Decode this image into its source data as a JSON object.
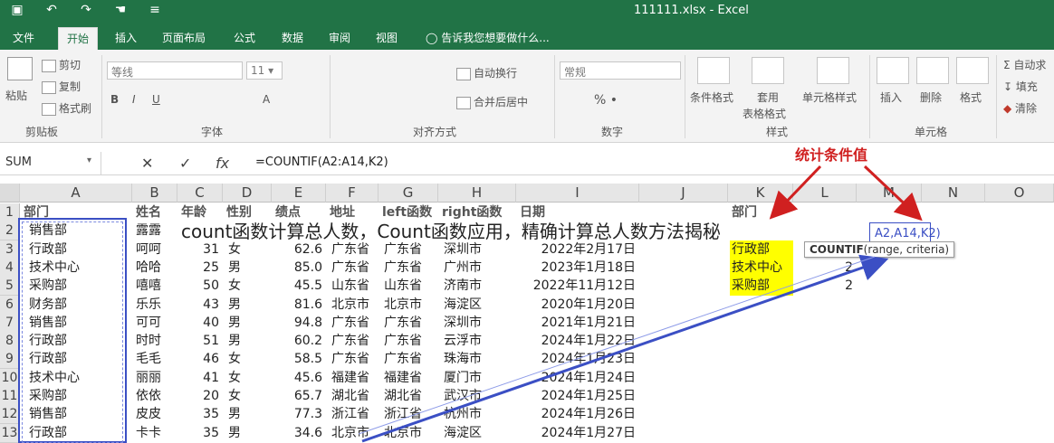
{
  "window": {
    "title": "111111.xlsx - Excel"
  },
  "qat": {
    "save_icon": "▣",
    "undo_icon": "↶",
    "redo_icon": "↷",
    "touch_icon": "☚",
    "more_icon": "≡"
  },
  "tabs": [
    "文件",
    "开始",
    "插入",
    "页面布局",
    "公式",
    "数据",
    "审阅",
    "视图"
  ],
  "tell_me": "告诉我您想要做什么...",
  "ribbon": {
    "paste": "粘贴",
    "cut": "剪切",
    "copy": "复制",
    "format_painter": "格式刷",
    "clipboard_group": "剪贴板",
    "font_name": "等线",
    "font_size": "11",
    "font_size_arrow": "▾",
    "font_group": "字体",
    "wrap_text": "自动换行",
    "merge_center": "合并后居中",
    "alignment_group": "对齐方式",
    "number_format": "常规",
    "percent": "% •",
    "number_group": "数字",
    "conditional_format": "条件格式",
    "table_format_1": "套用",
    "table_format_2": "表格格式",
    "cell_styles": "单元格样式",
    "styles_group": "样式",
    "insert": "插入",
    "delete": "删除",
    "format": "格式",
    "cells_group": "单元格",
    "autosum": "自动求",
    "fill": "填充",
    "clear": "清除"
  },
  "formula_bar": {
    "name_box": "SUM",
    "cancel": "✕",
    "enter": "✓",
    "fx": "fx",
    "formula": "=COUNTIF(A2:A14,K2)"
  },
  "columns": [
    "A",
    "B",
    "C",
    "D",
    "E",
    "F",
    "G",
    "H",
    "I",
    "J",
    "K",
    "L",
    "M",
    "N",
    "O"
  ],
  "headers": {
    "a": "部门",
    "b": "姓名",
    "c": "年龄",
    "d": "性别",
    "e": "绩点",
    "f": "地址",
    "g": "left函数",
    "h": "right函数",
    "i": "日期",
    "k": "部门"
  },
  "rows": [
    {
      "n": "2",
      "a": "销售部",
      "b": "露露",
      "c": "",
      "d": "",
      "e": "",
      "f": "",
      "g": "",
      "h": "",
      "i": "",
      "k": ""
    },
    {
      "n": "3",
      "a": "行政部",
      "b": "呵呵",
      "c": "31",
      "d": "女",
      "e": "62.6",
      "f": "广东省",
      "g": "广东省",
      "h": "深圳市",
      "i": "2022年2月17日",
      "k": "行政部"
    },
    {
      "n": "4",
      "a": "技术中心",
      "b": "哈哈",
      "c": "25",
      "d": "男",
      "e": "85.0",
      "f": "广东省",
      "g": "广东省",
      "h": "广州市",
      "i": "2023年1月18日",
      "k": "技术中心"
    },
    {
      "n": "5",
      "a": "采购部",
      "b": "嘻嘻",
      "c": "50",
      "d": "女",
      "e": "45.5",
      "f": "山东省",
      "g": "山东省",
      "h": "济南市",
      "i": "2022年11月12日",
      "k": "采购部"
    },
    {
      "n": "6",
      "a": "财务部",
      "b": "乐乐",
      "c": "43",
      "d": "男",
      "e": "81.6",
      "f": "北京市",
      "g": "北京市",
      "h": "海淀区",
      "i": "2020年1月20日",
      "k": ""
    },
    {
      "n": "7",
      "a": "销售部",
      "b": "可可",
      "c": "40",
      "d": "男",
      "e": "94.8",
      "f": "广东省",
      "g": "广东省",
      "h": "深圳市",
      "i": "2021年1月21日",
      "k": ""
    },
    {
      "n": "8",
      "a": "行政部",
      "b": "时时",
      "c": "51",
      "d": "男",
      "e": "60.2",
      "f": "广东省",
      "g": "广东省",
      "h": "云浮市",
      "i": "2024年1月22日",
      "k": ""
    },
    {
      "n": "9",
      "a": "行政部",
      "b": "毛毛",
      "c": "46",
      "d": "女",
      "e": "58.5",
      "f": "广东省",
      "g": "广东省",
      "h": "珠海市",
      "i": "2024年1月23日",
      "k": ""
    },
    {
      "n": "10",
      "a": "技术中心",
      "b": "丽丽",
      "c": "41",
      "d": "女",
      "e": "45.6",
      "f": "福建省",
      "g": "福建省",
      "h": "厦门市",
      "i": "2024年1月24日",
      "k": ""
    },
    {
      "n": "11",
      "a": "采购部",
      "b": "依依",
      "c": "20",
      "d": "女",
      "e": "65.7",
      "f": "湖北省",
      "g": "湖北省",
      "h": "武汉市",
      "i": "2024年1月25日",
      "k": ""
    },
    {
      "n": "12",
      "a": "销售部",
      "b": "皮皮",
      "c": "35",
      "d": "男",
      "e": "77.3",
      "f": "浙江省",
      "g": "浙江省",
      "h": "杭州市",
      "i": "2024年1月26日",
      "k": ""
    },
    {
      "n": "13",
      "a": "行政部",
      "b": "卡卡",
      "c": "35",
      "d": "男",
      "e": "34.6",
      "f": "北京市",
      "g": "北京市",
      "h": "海淀区",
      "i": "2024年1月27日",
      "k": ""
    }
  ],
  "row1_num": "1",
  "count_values": {
    "r4": "2",
    "r5": "2"
  },
  "formula_ref": "A2,A14,K2)",
  "tooltip": {
    "fn": "COUNTIF",
    "args": "(range, criteria)"
  },
  "annotation": "统计条件值",
  "overlay_title": "count函数计算总人数，Count函数应用，精确计算总人数方法揭秘",
  "colors": {
    "excel_green": "#217346",
    "highlight_yellow": "#ffff00",
    "arrow_red": "#d02020",
    "range_blue": "#3b4fc4"
  }
}
